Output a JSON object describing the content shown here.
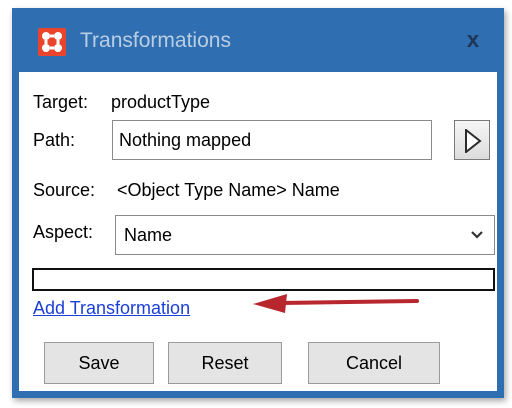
{
  "window": {
    "title": "Transformations",
    "close_symbol": "x",
    "icon": "transformations-app-icon"
  },
  "target": {
    "label": "Target:",
    "value": "productType"
  },
  "path": {
    "label": "Path:",
    "value": "Nothing mapped",
    "button_icon": "play-arrow-icon"
  },
  "source": {
    "label": "Source:",
    "value": "<Object Type Name> Name"
  },
  "aspect": {
    "label": "Aspect:",
    "selected": "Name"
  },
  "actions": {
    "add_transformation": "Add Transformation"
  },
  "buttons": {
    "save": "Save",
    "reset": "Reset",
    "cancel": "Cancel"
  },
  "colors": {
    "titlebar": "#2f6fb1",
    "icon": "#e8452c",
    "link": "#1a3fd6",
    "annotation_arrow": "#b8262e"
  }
}
